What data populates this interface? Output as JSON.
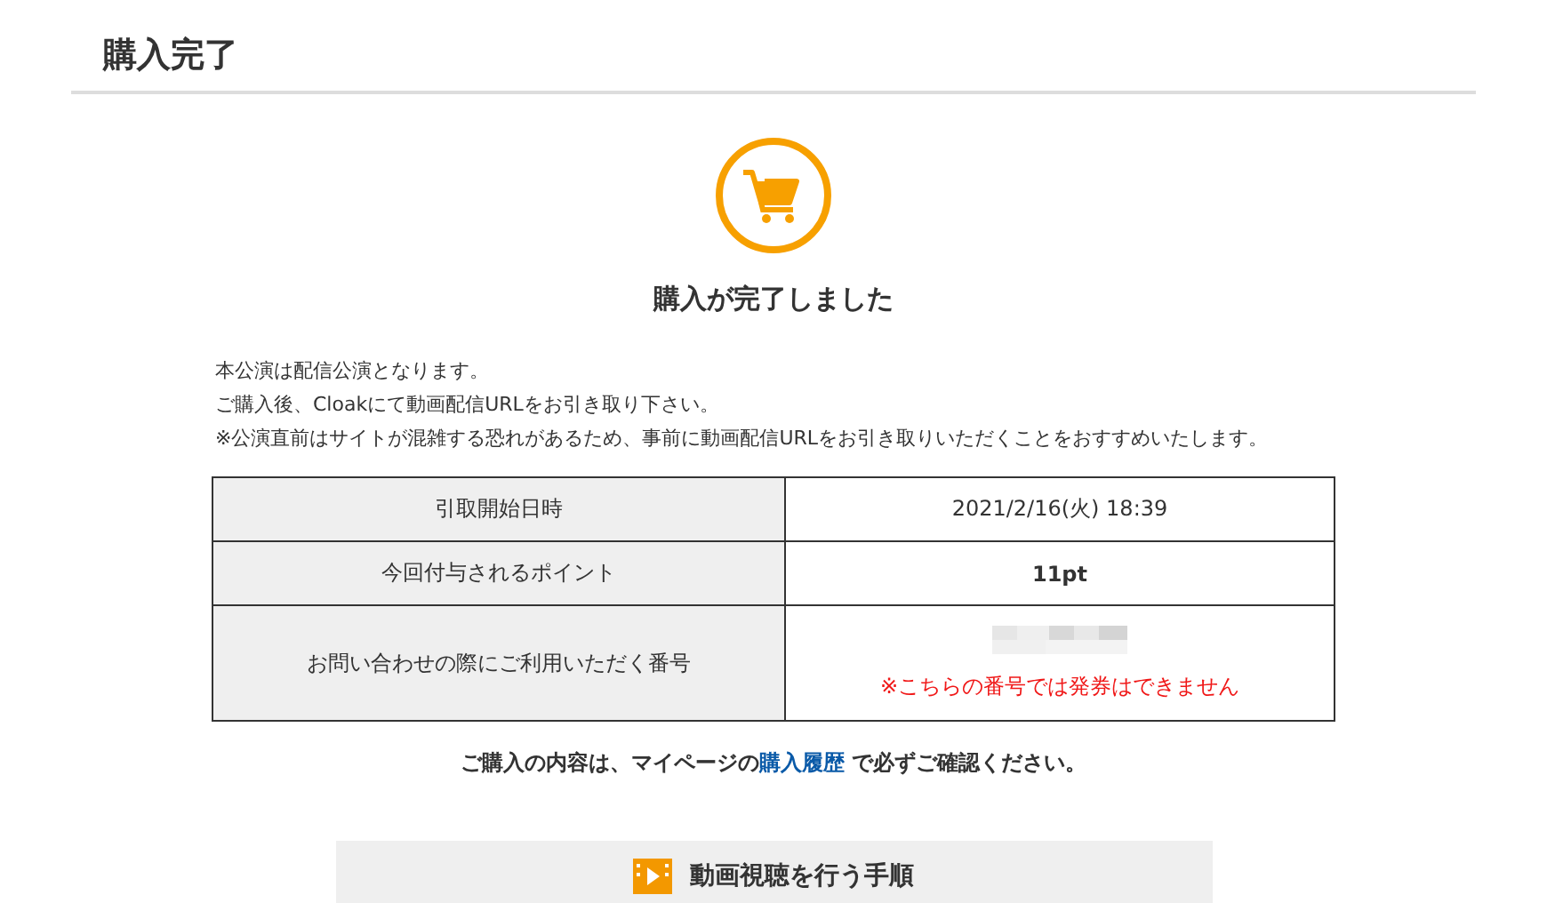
{
  "page_title": "購入完了",
  "heading": "購入が完了しました",
  "notes": [
    "本公演は配信公演となります。",
    "ご購入後、Cloakにて動画配信URLをお引き取り下さい。",
    "※公演直前はサイトが混雑する恐れがあるため、事前に動画配信URLをお引き取りいただくことをおすすめいたします。"
  ],
  "table": {
    "rows": [
      {
        "label": "引取開始日時",
        "kind": "text",
        "value": "2021/2/16(火) 18:39"
      },
      {
        "label": "今回付与されるポイント",
        "kind": "bold",
        "value": "11pt"
      },
      {
        "label": "お問い合わせの際にご利用いただく番号",
        "kind": "masked",
        "warning": "※こちらの番号では発券はできません"
      }
    ]
  },
  "confirm": {
    "before": "ご購入の内容は、マイページの",
    "link": "購入履歴",
    "after": " で必ずご確認ください。"
  },
  "steps_panel": {
    "title": "動画視聴を行う手順"
  }
}
